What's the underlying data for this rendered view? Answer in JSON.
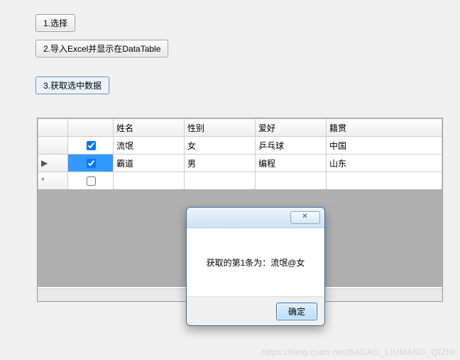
{
  "buttons": {
    "btn1": "1.选择",
    "btn2": "2.导入Excel并显示在DataTable",
    "btn3": "3.获取选中数据"
  },
  "grid": {
    "columns": [
      "",
      "",
      "姓名",
      "性别",
      "爱好",
      "籍贯"
    ],
    "rows": [
      {
        "indicator": "",
        "checked": true,
        "cells": [
          "流氓",
          "女",
          "乒乓球",
          "中国"
        ],
        "selected": false
      },
      {
        "indicator": "▶",
        "checked": true,
        "cells": [
          "霸道",
          "男",
          "编程",
          "山东"
        ],
        "selected": true
      },
      {
        "indicator": "*",
        "checked": false,
        "cells": [
          "",
          "",
          "",
          ""
        ],
        "selected": false
      }
    ]
  },
  "dialog": {
    "message": "获取的第1条为：流氓@女",
    "ok": "确定",
    "close": "✕"
  },
  "watermark": "https://blog.csdn.net/BADAO_LIUMANG_QIZHI"
}
